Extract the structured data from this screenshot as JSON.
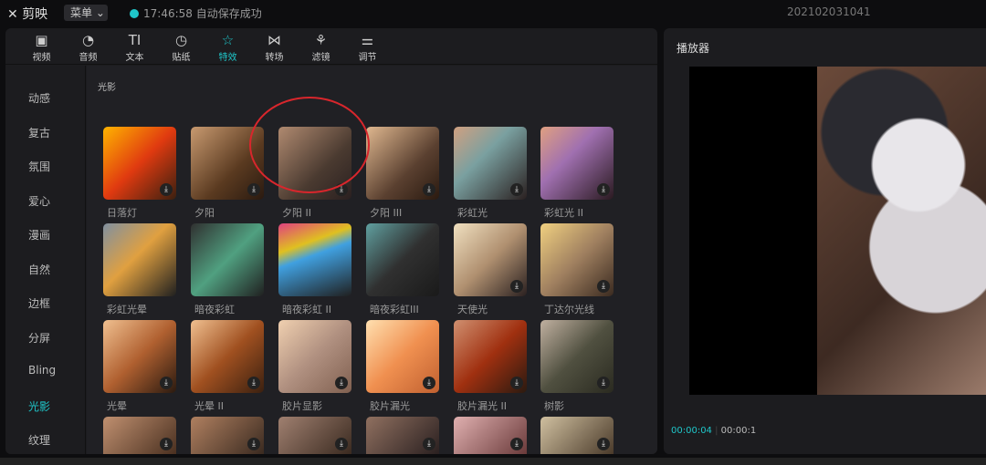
{
  "app": {
    "name": "剪映",
    "menu": "菜单",
    "save_status": "17:46:58 自动保存成功",
    "project": "202102031041"
  },
  "toolbar": [
    {
      "label": "视频",
      "icon": "video-icon"
    },
    {
      "label": "音频",
      "icon": "audio-icon"
    },
    {
      "label": "文本",
      "icon": "text-icon"
    },
    {
      "label": "贴纸",
      "icon": "sticker-icon"
    },
    {
      "label": "特效",
      "icon": "effects-icon",
      "active": true
    },
    {
      "label": "转场",
      "icon": "transition-icon"
    },
    {
      "label": "滤镜",
      "icon": "filter-icon"
    },
    {
      "label": "调节",
      "icon": "adjust-icon"
    }
  ],
  "sidebar": [
    "动感",
    "复古",
    "氛围",
    "爱心",
    "漫画",
    "自然",
    "边框",
    "分屏",
    "Bling",
    "光影",
    "纹理"
  ],
  "sidebar_active": "光影",
  "section": "光影",
  "effects": [
    "日落灯",
    "夕阳",
    "夕阳 II",
    "夕阳 III",
    "彩虹光",
    "彩虹光 II",
    "彩虹光晕",
    "暗夜彩虹",
    "暗夜彩虹 II",
    "暗夜彩虹III",
    "天使光",
    "丁达尔光线",
    "光晕",
    "光晕 II",
    "胶片显影",
    "胶片漏光",
    "胶片漏光 II",
    "树影"
  ],
  "player": {
    "title": "播放器",
    "current": "00:00:04",
    "total": "00:00:1"
  },
  "colors": {
    "accent": "#1fc6c9",
    "highlight": "#d8262c"
  }
}
